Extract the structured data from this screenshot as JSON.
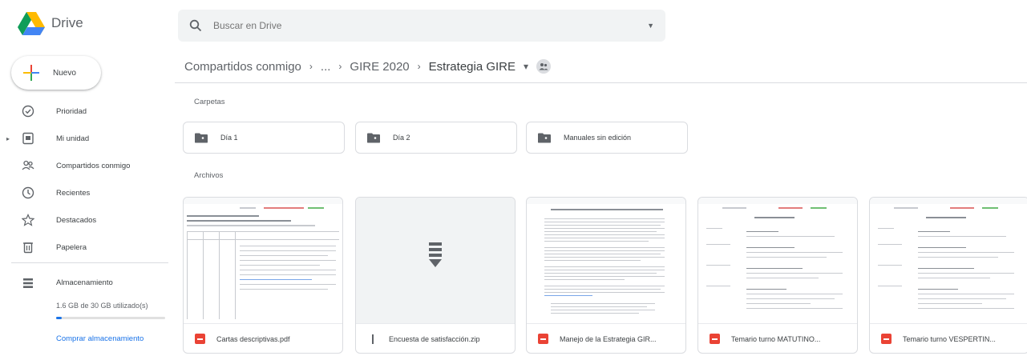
{
  "app": {
    "name": "Drive"
  },
  "search": {
    "placeholder": "Buscar en Drive"
  },
  "new_button": {
    "label": "Nuevo"
  },
  "sidebar": {
    "items": [
      {
        "label": "Prioridad",
        "icon": "priority-icon"
      },
      {
        "label": "Mi unidad",
        "icon": "my-drive-icon"
      },
      {
        "label": "Compartidos conmigo",
        "icon": "shared-with-me-icon"
      },
      {
        "label": "Recientes",
        "icon": "clock-icon"
      },
      {
        "label": "Destacados",
        "icon": "star-icon"
      },
      {
        "label": "Papelera",
        "icon": "trash-icon"
      }
    ]
  },
  "storage": {
    "label": "Almacenamiento",
    "usage": "1.6 GB de 30 GB utilizado(s)",
    "used_fraction": 0.053,
    "buy_label": "Comprar almacenamiento"
  },
  "breadcrumb": {
    "items": [
      "Compartidos conmigo",
      "...",
      "GIRE 2020",
      "Estrategia GIRE"
    ],
    "separator": "›",
    "dropdown": "▾"
  },
  "sections": {
    "folders": "Carpetas",
    "files": "Archivos"
  },
  "folders": [
    {
      "name": "Día 1"
    },
    {
      "name": "Día 2"
    },
    {
      "name": "Manuales sin edición"
    }
  ],
  "files": [
    {
      "name": "Cartas descriptivas.pdf",
      "type": "pdf"
    },
    {
      "name": "Encuesta de satisfacción.zip",
      "type": "zip"
    },
    {
      "name": "Manejo de la Estrategia GIR...",
      "type": "pdf"
    },
    {
      "name": "Temario turno MATUTINO...",
      "type": "pdf"
    },
    {
      "name": "Temario turno VESPERTIN...",
      "type": "pdf"
    }
  ],
  "colors": {
    "accent": "#1a73e8",
    "pdf_red": "#ea4335",
    "folder_gray": "#5f6368"
  }
}
